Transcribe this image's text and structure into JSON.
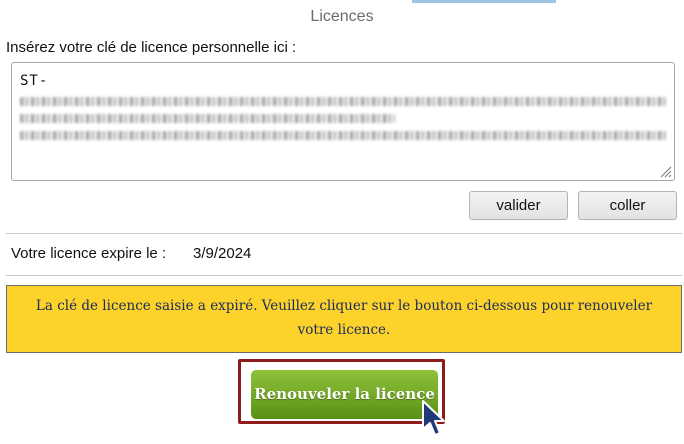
{
  "panel": {
    "title": "Licences"
  },
  "license": {
    "prompt": "Insérez votre clé de licence personnelle ici :",
    "key_prefix": "ST-",
    "validate_label": "valider",
    "paste_label": "coller"
  },
  "expiry": {
    "label": "Votre licence expire le :",
    "date": "3/9/2024"
  },
  "notice": {
    "message": "La clé de licence saisie a expiré. Veuillez cliquer sur le bouton ci-dessous pour renouveler votre licence."
  },
  "renew": {
    "label": "Renouveler la licence"
  },
  "colors": {
    "notice_background": "#fdd32b",
    "notice_text": "#1a2b5c",
    "renew_button": "#6fa523",
    "highlight_border": "#8e1b1b"
  },
  "icons": {
    "cursor": "arrow-cursor-icon",
    "grip": "resize-grip-icon"
  }
}
